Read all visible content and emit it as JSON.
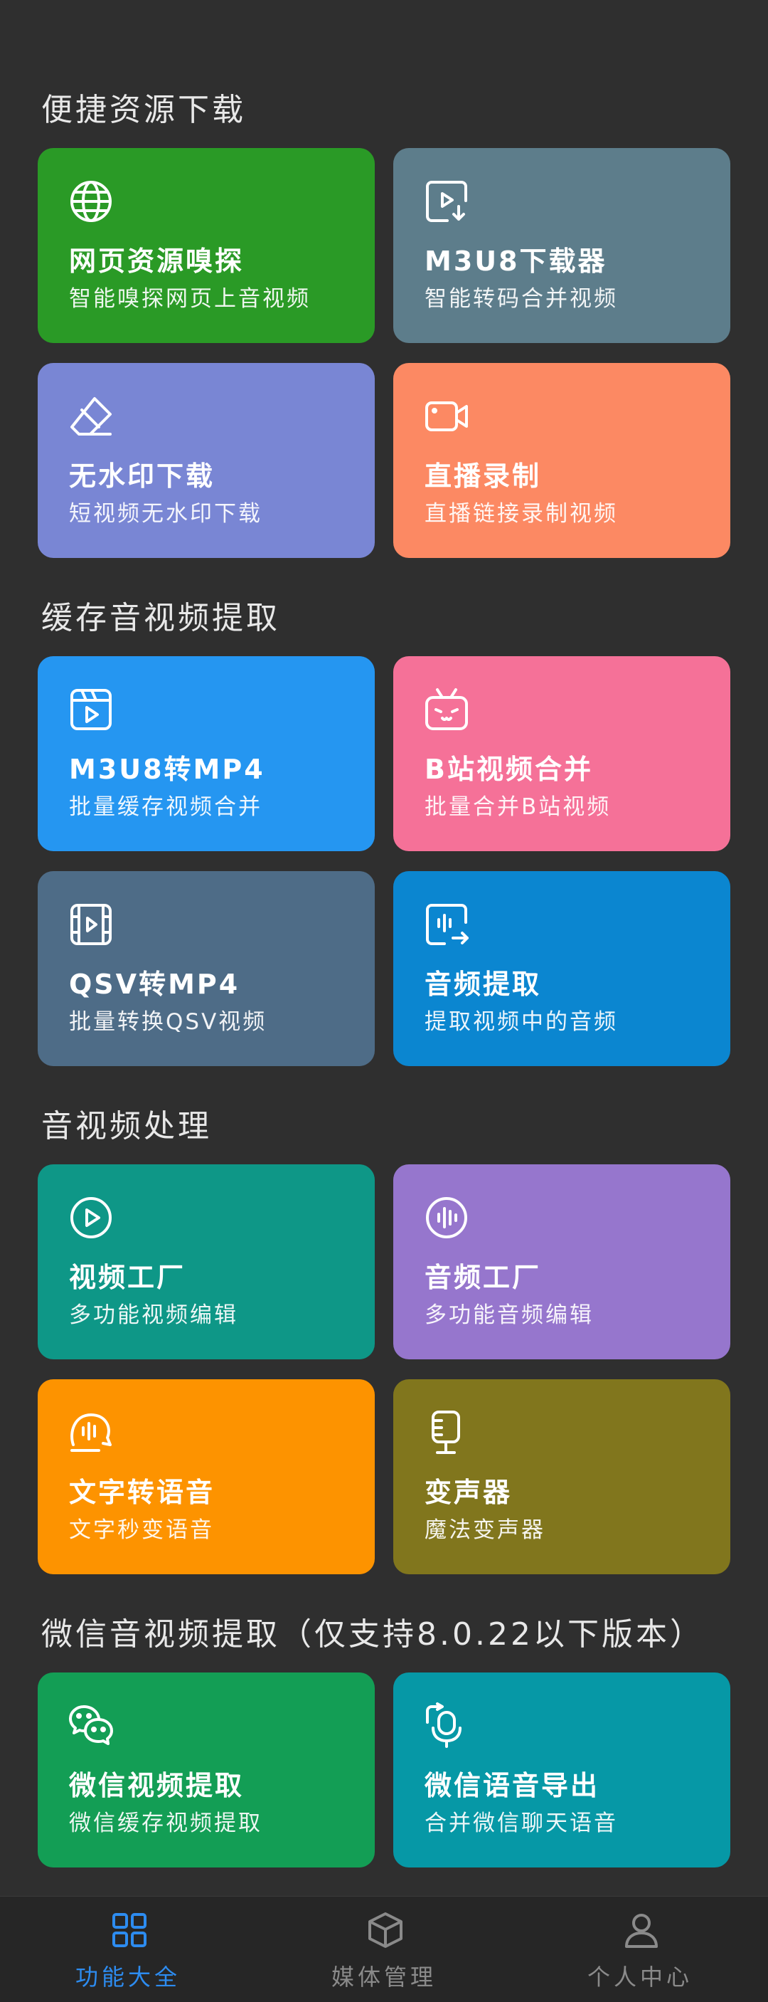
{
  "sections": [
    {
      "title": "便捷资源下载",
      "cards": [
        {
          "title": "网页资源嗅探",
          "subtitle": "智能嗅探网页上音视频",
          "icon": "globe-icon",
          "color": "#2a9a26"
        },
        {
          "title": "M3U8下载器",
          "subtitle": "智能转码合并视频",
          "icon": "video-download-icon",
          "color": "#5d7d8b"
        },
        {
          "title": "无水印下载",
          "subtitle": "短视频无水印下载",
          "icon": "eraser-icon",
          "color": "#7986d4"
        },
        {
          "title": "直播录制",
          "subtitle": "直播链接录制视频",
          "icon": "camera-icon",
          "color": "#fc8963"
        }
      ]
    },
    {
      "title": "缓存音视频提取",
      "cards": [
        {
          "title": "M3U8转MP4",
          "subtitle": "批量缓存视频合并",
          "icon": "clapperboard-icon",
          "color": "#2596f1"
        },
        {
          "title": "B站视频合并",
          "subtitle": "批量合并B站视频",
          "icon": "bilibili-icon",
          "color": "#f57198"
        },
        {
          "title": "QSV转MP4",
          "subtitle": "批量转换QSV视频",
          "icon": "film-icon",
          "color": "#4e6c87"
        },
        {
          "title": "音频提取",
          "subtitle": "提取视频中的音频",
          "icon": "audio-extract-icon",
          "color": "#0b86d0"
        }
      ]
    },
    {
      "title": "音视频处理",
      "cards": [
        {
          "title": "视频工厂",
          "subtitle": "多功能视频编辑",
          "icon": "play-circle-icon",
          "color": "#0e9787"
        },
        {
          "title": "音频工厂",
          "subtitle": "多功能音频编辑",
          "icon": "audio-wave-icon",
          "color": "#9676cd"
        },
        {
          "title": "文字转语音",
          "subtitle": "文字秒变语音",
          "icon": "speech-icon",
          "color": "#fd9300"
        },
        {
          "title": "变声器",
          "subtitle": "魔法变声器",
          "icon": "microphone-icon",
          "color": "#81761d"
        }
      ]
    },
    {
      "title": "微信音视频提取（仅支持8.0.22以下版本）",
      "cards": [
        {
          "title": "微信视频提取",
          "subtitle": "微信缓存视频提取",
          "icon": "wechat-icon",
          "color": "#139e55"
        },
        {
          "title": "微信语音导出",
          "subtitle": "合并微信聊天语音",
          "icon": "voice-export-icon",
          "color": "#0698a6"
        }
      ]
    }
  ],
  "bottom_nav": [
    {
      "label": "功能大全",
      "icon": "grid-icon",
      "active": true
    },
    {
      "label": "媒体管理",
      "icon": "box-icon",
      "active": false
    },
    {
      "label": "个人中心",
      "icon": "user-icon",
      "active": false
    }
  ],
  "colors": {
    "background": "#2f2f2f",
    "nav_background": "#262626",
    "nav_active": "#2d8cf0",
    "nav_inactive": "#8a8a8a"
  }
}
